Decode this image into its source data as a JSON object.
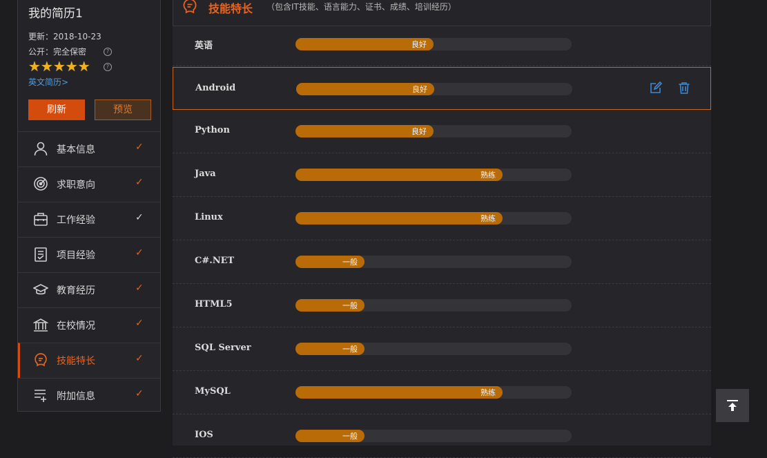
{
  "profile": {
    "title": "我的简历1",
    "updated": "更新：2018-10-23",
    "public": "公开：完全保密",
    "help_glyph": "?",
    "stars": "★★★★★",
    "english_link": "英文简历>",
    "refresh_label": "刷新",
    "preview_label": "预览"
  },
  "nav": {
    "items": [
      {
        "label": "基本信息",
        "icon": "user-icon",
        "check": "✓"
      },
      {
        "label": "求职意向",
        "icon": "target-icon",
        "check": "✓"
      },
      {
        "label": "工作经验",
        "icon": "briefcase-icon",
        "check": "✓"
      },
      {
        "label": "项目经验",
        "icon": "clipboard-check-icon",
        "check": "✓"
      },
      {
        "label": "教育经历",
        "icon": "graduation-cap-icon",
        "check": "✓"
      },
      {
        "label": "在校情况",
        "icon": "school-building-icon",
        "check": "✓"
      },
      {
        "label": "技能特长",
        "icon": "skill-bulb-icon",
        "check": "✓"
      },
      {
        "label": "附加信息",
        "icon": "list-add-icon",
        "check": "✓"
      }
    ]
  },
  "section": {
    "title": "技能特长",
    "subtitle": "（包含IT技能、语言能力、证书、成绩、培训经历）"
  },
  "skills": [
    {
      "name": "英语",
      "level": "良好",
      "fill": 0.5
    },
    {
      "name": "Android",
      "level": "良好",
      "fill": 0.5
    },
    {
      "name": "Python",
      "level": "良好",
      "fill": 0.5
    },
    {
      "name": "Java",
      "level": "熟练",
      "fill": 0.75
    },
    {
      "name": "Linux",
      "level": "熟练",
      "fill": 0.75
    },
    {
      "name": "C#.NET",
      "level": "一般",
      "fill": 0.25
    },
    {
      "name": "HTML5",
      "level": "一般",
      "fill": 0.25
    },
    {
      "name": "SQL Server",
      "level": "一般",
      "fill": 0.25
    },
    {
      "name": "MySQL",
      "level": "熟练",
      "fill": 0.75
    },
    {
      "name": "IOS",
      "level": "一般",
      "fill": 0.25
    }
  ],
  "colors": {
    "accent": "#d44b0e",
    "bar_fill": "#b96b08",
    "action_blue": "#3a8ad8"
  }
}
